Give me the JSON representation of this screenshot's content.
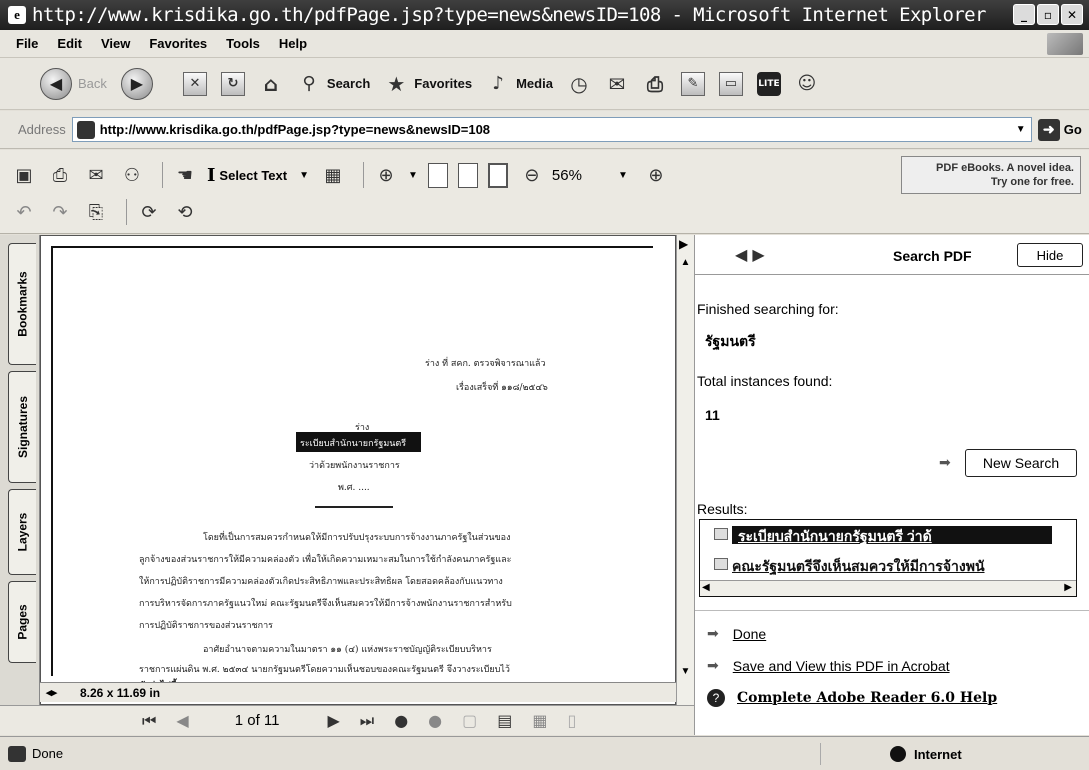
{
  "window": {
    "title": "http://www.krisdika.go.th/pdfPage.jsp?type=news&newsID=108 - Microsoft Internet Explorer"
  },
  "menu": [
    "File",
    "Edit",
    "View",
    "Favorites",
    "Tools",
    "Help"
  ],
  "std_toolbar": {
    "back_label": "Back",
    "search_label": "Search",
    "favorites_label": "Favorites",
    "media_label": "Media"
  },
  "address": {
    "label": "Address",
    "url": "http://www.krisdika.go.th/pdfPage.jsp?type=news&newsID=108",
    "go_label": "Go"
  },
  "acrobat": {
    "select_text_label": "Select Text",
    "zoom": "56%",
    "ebook_ad_line1": "PDF eBooks. A novel idea.",
    "ebook_ad_line2": "Try one for free."
  },
  "left_tabs": [
    "Bookmarks",
    "Signatures",
    "Layers",
    "Pages"
  ],
  "document": {
    "page_size": "8.26 x 11.69 in",
    "header_right_1": "ร่าง ที่ สคก. ตรวจพิจารณาแล้ว",
    "header_right_2": "เรื่องเสร็จที่ ๑๑๘/๒๕๔๖",
    "center_1": "ร่าง",
    "center_2": "ระเบียบสำนักนายกรัฐมนตรี",
    "center_3": "ว่าด้วยพนักงานราชการ",
    "center_4": "พ.ศ. ....",
    "para_lines": [
      "โดยที่เป็นการสมควรกำหนดให้มีการปรับปรุงระบบการจ้างงานภาครัฐในส่วนของ",
      "ลูกจ้างของส่วนราชการให้มีความคล่องตัว เพื่อให้เกิดความเหมาะสมในการใช้กำลังคนภาครัฐและ",
      "ให้การปฏิบัติราชการมีความคล่องตัวเกิดประสิทธิภาพและประสิทธิผล โดยสอดคล้องกับแนวทาง",
      "การบริหารจัดการภาครัฐแนวใหม่ คณะรัฐมนตรีจึงเห็นสมควรให้มีการจ้างพนักงานราชการสำหรับ",
      "การปฏิบัติราชการของส่วนราชการ",
      "อาศัยอำนาจตามความในมาตรา ๑๑ (๔) แห่งพระราชบัญญัติระเบียบบริหาร",
      "ราชการแผ่นดิน พ.ศ. ๒๕๓๔ นายกรัฐมนตรีโดยความเห็นชอบของคณะรัฐมนตรี จึงวางระเบียบไว้",
      "ดังต่อไปนี้"
    ]
  },
  "nav": {
    "page_indicator": "1 of 11"
  },
  "search_pane": {
    "title": "Search PDF",
    "hide_label": "Hide",
    "finished_label": "Finished searching for:",
    "search_term": "รัฐมนตรี",
    "total_label": "Total instances found:",
    "total_count": "11",
    "new_search_label": "New Search",
    "results_label": "Results:",
    "result_1": "ระเบียบสำนักนายกรัฐมนตรี ว่าด้",
    "result_2": "คณะรัฐมนตรีจึงเห็นสมควรให้มีการจ้างพนั",
    "link_done": "Done",
    "link_save": "Save and View this PDF in Acrobat",
    "link_help": "Complete Adobe Reader 6.0 Help"
  },
  "status": {
    "text": "Done",
    "zone": "Internet"
  },
  "colors": {
    "title_bg": "#2b2b2b",
    "link": "#000000"
  }
}
